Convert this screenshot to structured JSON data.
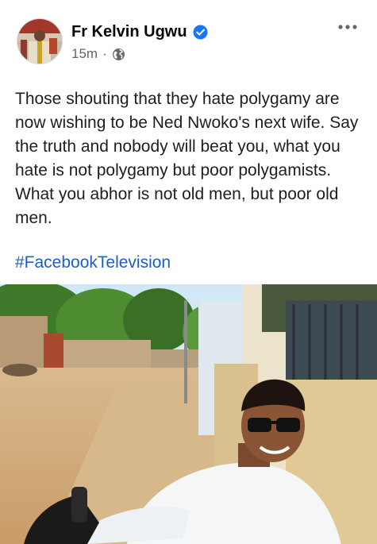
{
  "post": {
    "author": {
      "name": "Fr Kelvin Ugwu",
      "verified_icon": "verified-badge-icon",
      "verified_color": "#1877f2"
    },
    "timestamp": "15m",
    "separator": "·",
    "privacy_icon": "globe-icon",
    "more_icon": "more-options-icon",
    "text": "Those shouting that they hate polygamy are now wishing to be Ned Nwoko's next wife. Say the truth and nobody will beat you, what you hate is not polygamy but poor polygamists. What you abhor is not old men, but poor old men.",
    "hashtag": "#FacebookTelevision",
    "hashtag_color": "#1b5fc4",
    "photo_subject": "smiling man in sunglasses and white shirt on a motorcycle beside a dirt road"
  }
}
